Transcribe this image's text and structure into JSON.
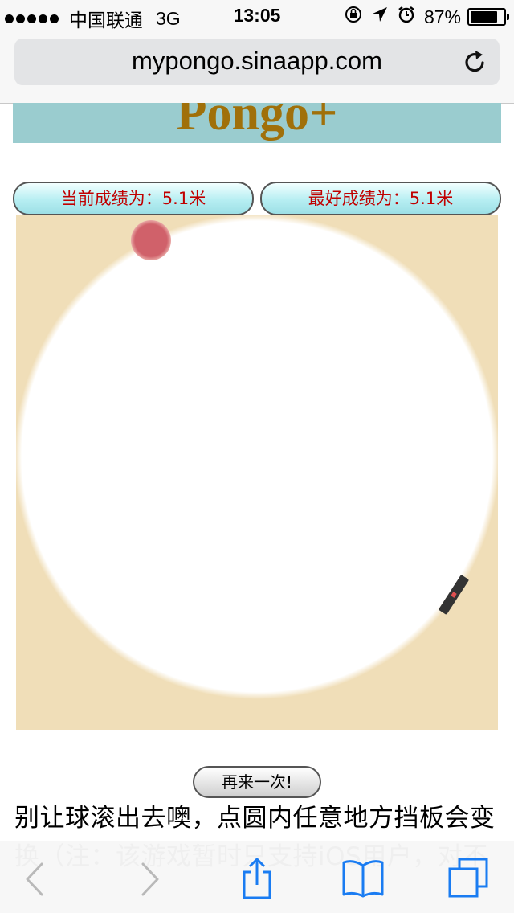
{
  "status_bar": {
    "carrier": "中国联通",
    "network": "3G",
    "time": "13:05",
    "battery_percent": "87%",
    "battery_level": 0.87,
    "icons": [
      "orientation-lock-icon",
      "location-arrow-icon",
      "alarm-icon",
      "battery-icon"
    ]
  },
  "address_bar": {
    "url": "mypongo.sinaapp.com",
    "reload_icon": "reload-icon"
  },
  "page": {
    "title": "Pongo+",
    "current_score": "当前成绩为：5.1米",
    "best_score": "最好成绩为：5.1米",
    "retry_label": "再来一次!",
    "instructions": "别让球滚出去噢，点圆内任意地方挡板会变换（注：该游戏暂时只支持iOS用户，对不"
  },
  "colors": {
    "banner_bg": "#9acccf",
    "title_color": "#a0700a",
    "game_bg": "#f0deb8",
    "ball": "#d0616a",
    "paddle": "#333333",
    "score_text": "#c00000"
  },
  "toolbar": {
    "items": [
      "back-icon",
      "forward-icon",
      "share-icon",
      "bookmarks-icon",
      "tabs-icon"
    ]
  }
}
